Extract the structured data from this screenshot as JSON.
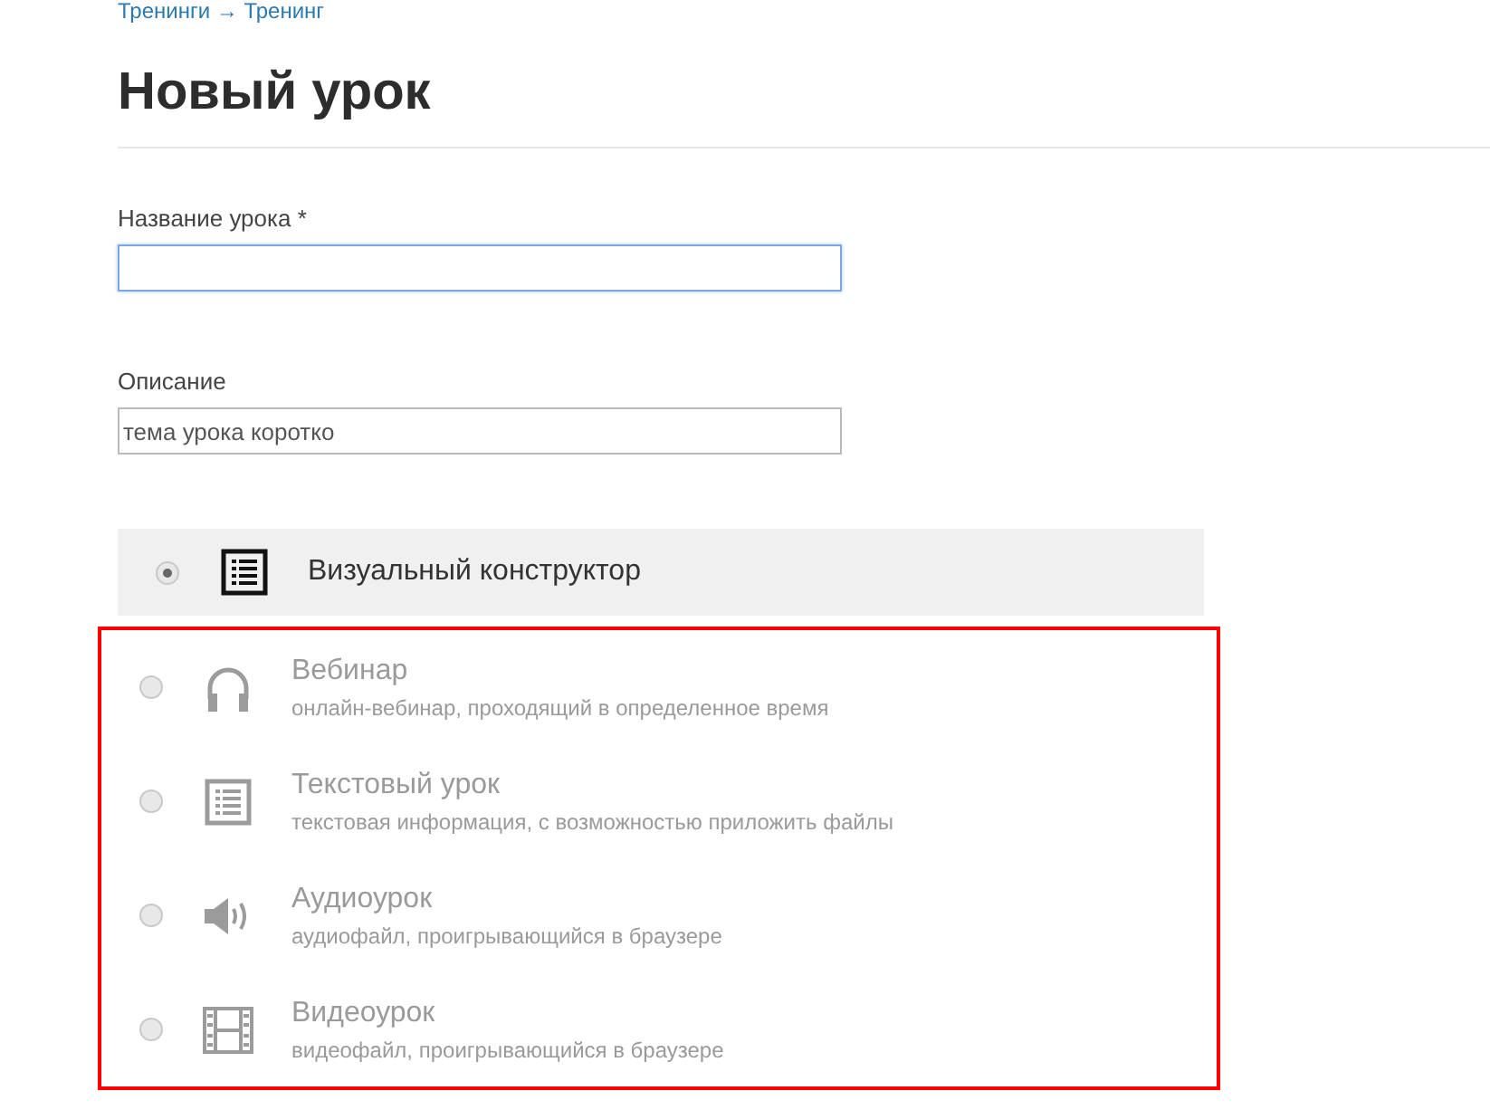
{
  "breadcrumb": "Тренинги → Тренинг",
  "title": "Новый урок",
  "fields": [
    {
      "label": "Название урока",
      "required_mark": "*",
      "focused": true
    },
    {
      "label": "Описание",
      "value": "тема урока коротко",
      "focused": false
    }
  ],
  "lesson_types": [
    {
      "kind": "constructor",
      "name": "Визуальный конструктор",
      "selected": true,
      "disabled": false
    },
    {
      "kind": "webinar",
      "name": "Вебинар",
      "description": "онлайн-вебинар, проходящий в определенное время",
      "selected": false,
      "disabled": true
    },
    {
      "kind": "text",
      "name": "Текстовый урок",
      "description": "текстовая информация, с возможностью приложить файлы",
      "selected": false,
      "disabled": true
    },
    {
      "kind": "audio",
      "name": "Аудиоурок",
      "description": "аудиофайл, проигрывающийся в браузере",
      "selected": false,
      "disabled": true
    },
    {
      "kind": "video",
      "name": "Видеоурок",
      "description": "видеофайл, проигрывающийся в браузере",
      "selected": false,
      "disabled": true
    }
  ]
}
